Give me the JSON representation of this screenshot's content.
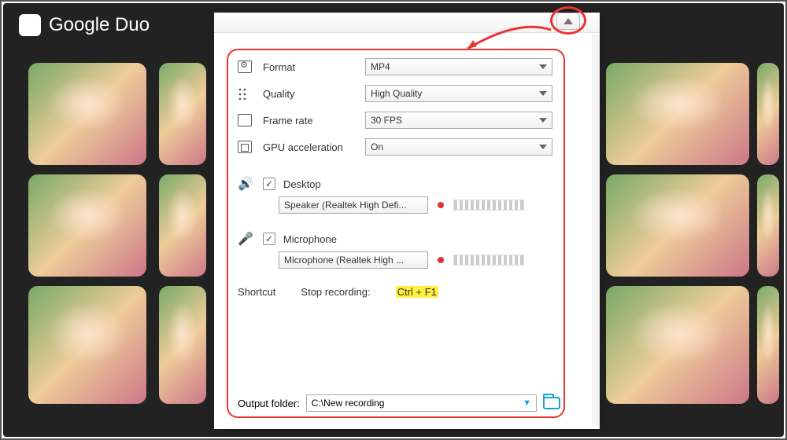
{
  "brand": {
    "name": "Google Duo"
  },
  "video_settings": {
    "format": {
      "label": "Format",
      "value": "MP4"
    },
    "quality": {
      "label": "Quality",
      "value": "High Quality"
    },
    "fps": {
      "label": "Frame rate",
      "value": "30 FPS"
    },
    "gpu": {
      "label": "GPU acceleration",
      "value": "On"
    }
  },
  "audio": {
    "desktop": {
      "label": "Desktop",
      "device": "Speaker (Realtek High Defi..."
    },
    "microphone": {
      "label": "Microphone",
      "device": "Microphone (Realtek High ..."
    }
  },
  "shortcut": {
    "section_label": "Shortcut",
    "stop_label": "Stop recording:",
    "key": "Ctrl + F1"
  },
  "output": {
    "label": "Output folder:",
    "path": "C:\\New recording"
  }
}
